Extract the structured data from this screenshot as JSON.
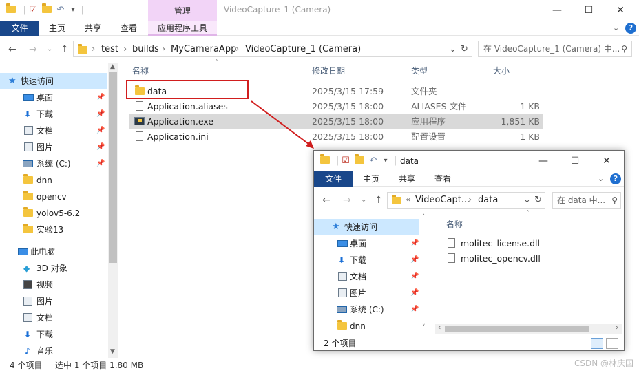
{
  "main": {
    "title": "VideoCapture_1 (Camera)",
    "context_tab": "管理",
    "ribbon_tabs": [
      "文件",
      "主页",
      "共享",
      "查看",
      "应用程序工具"
    ],
    "breadcrumbs": [
      "test",
      "builds",
      "MyCameraApp",
      "VideoCapture_1 (Camera)"
    ],
    "search_placeholder": "在 VideoCapture_1 (Camera) 中...",
    "sidebar": {
      "quick_access": "快速访问",
      "quick_items": [
        "桌面",
        "下载",
        "文档",
        "图片",
        "系统 (C:)",
        "dnn",
        "opencv",
        "yolov5-6.2",
        "实验13"
      ],
      "this_pc": "此电脑",
      "pc_items": [
        "3D 对象",
        "视频",
        "图片",
        "文档",
        "下载",
        "音乐"
      ]
    },
    "columns": {
      "name": "名称",
      "date": "修改日期",
      "type": "类型",
      "size": "大小"
    },
    "files": [
      {
        "name": "data",
        "date": "2025/3/15 17:59",
        "type": "文件夹",
        "size": ""
      },
      {
        "name": "Application.aliases",
        "date": "2025/3/15 18:00",
        "type": "ALIASES 文件",
        "size": "1 KB"
      },
      {
        "name": "Application.exe",
        "date": "2025/3/15 18:00",
        "type": "应用程序",
        "size": "1,851 KB"
      },
      {
        "name": "Application.ini",
        "date": "2025/3/15 18:00",
        "type": "配置设置",
        "size": "1 KB"
      }
    ],
    "status": {
      "count": "4 个项目",
      "selected": "选中 1 个项目 1.80 MB"
    }
  },
  "popup": {
    "title": "data",
    "ribbon_tabs": [
      "文件",
      "主页",
      "共享",
      "查看"
    ],
    "breadcrumbs": [
      "VideoCapt...",
      "data"
    ],
    "search_placeholder": "在 data 中...",
    "sidebar": {
      "quick_access": "快速访问",
      "items": [
        "桌面",
        "下载",
        "文档",
        "图片",
        "系统 (C:)",
        "dnn"
      ]
    },
    "column_name": "名称",
    "files": [
      "molitec_license.dll",
      "molitec_opencv.dll"
    ],
    "status": "2 个项目"
  },
  "watermark": "CSDN @林庆国",
  "colors": {
    "file_tab": "#19478a",
    "context_tab": "#f2d4f7",
    "selection": "#cce8ff",
    "highlight_box": "#d11e1e"
  }
}
